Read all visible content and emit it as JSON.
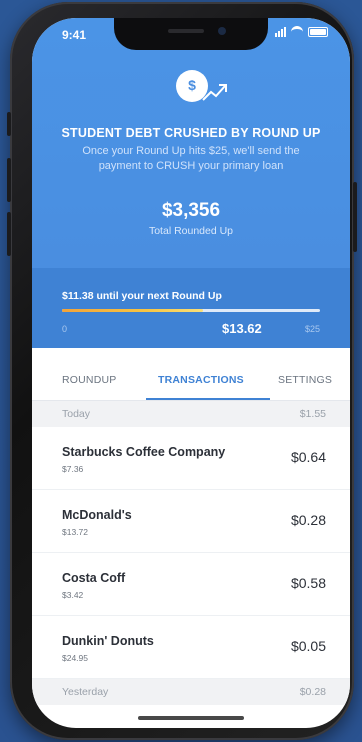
{
  "status_bar": {
    "time": "9:41"
  },
  "hero": {
    "logo_symbol": "$",
    "title": "STUDENT DEBT CRUSHED BY ROUND UP",
    "subtitle": "Once your Round Up hits $25, we'll send the payment to CRUSH your primary loan",
    "total_amount": "$3,356",
    "total_label": "Total Rounded Up"
  },
  "progress": {
    "until_text": "$11.38 until your next Round Up",
    "min_label": "0",
    "current_label": "$13.62",
    "max_label": "$25",
    "fraction": 0.5448
  },
  "tabs": [
    {
      "label": "ROUNDUP",
      "active": false
    },
    {
      "label": "TRANSACTIONS",
      "active": true
    },
    {
      "label": "SETTINGS",
      "active": false
    }
  ],
  "sections": [
    {
      "label": "Today",
      "total": "$1.55"
    },
    {
      "label": "Yesterday",
      "total": "$0.28"
    }
  ],
  "transactions": [
    {
      "name": "Starbucks Coffee Company",
      "amount": "$7.36",
      "roundup": "$0.64"
    },
    {
      "name": "McDonald's",
      "amount": "$13.72",
      "roundup": "$0.28"
    },
    {
      "name": "Costa Coff",
      "amount": "$3.42",
      "roundup": "$0.58"
    },
    {
      "name": "Dunkin' Donuts",
      "amount": "$24.95",
      "roundup": "$0.05"
    }
  ],
  "colors": {
    "primary_blue": "#4a8ee0",
    "progress_band": "#3f82d4",
    "progress_fill_start": "#f2a33a",
    "progress_fill_end": "#f9e07a"
  },
  "icons": [
    "dollar-coin-icon",
    "trend-arrow-icon",
    "signal-icon",
    "wifi-icon",
    "battery-icon"
  ]
}
